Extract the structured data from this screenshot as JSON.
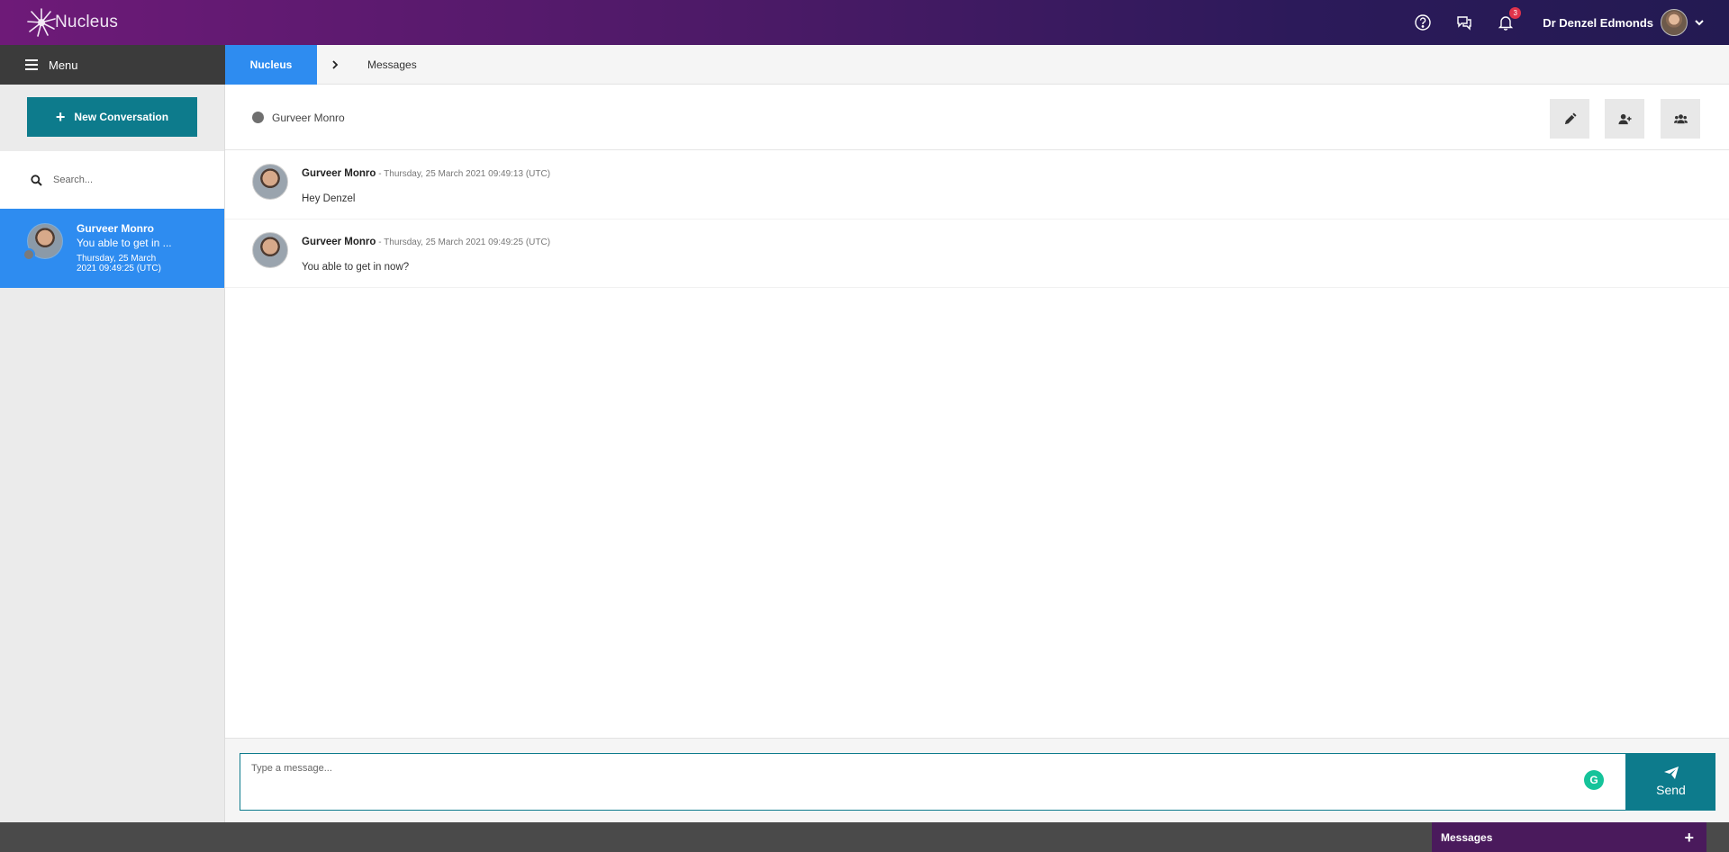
{
  "app": {
    "name": "Nucleus",
    "notification_count": "3",
    "user_name": "Dr Denzel Edmonds"
  },
  "nav": {
    "menu_label": "Menu",
    "breadcrumb": {
      "home": "Nucleus",
      "current": "Messages"
    }
  },
  "sidebar": {
    "new_conversation_label": "New Conversation",
    "search_placeholder": "Search...",
    "conversations": [
      {
        "name": "Gurveer Monro",
        "preview": "You able to get in ...",
        "time": "Thursday, 25 March 2021 09:49:25 (UTC)"
      }
    ]
  },
  "conversation": {
    "participant": "Gurveer Monro",
    "messages": [
      {
        "author": "Gurveer Monro",
        "timestamp": " - Thursday, 25 March 2021 09:49:13 (UTC)",
        "text": "Hey Denzel"
      },
      {
        "author": "Gurveer Monro",
        "timestamp": " - Thursday, 25 March 2021 09:49:25 (UTC)",
        "text": "You able to get in now?"
      }
    ]
  },
  "composer": {
    "placeholder": "Type a message...",
    "send_label": "Send"
  },
  "footer": {
    "messages_label": "Messages"
  },
  "colors": {
    "primary_blue": "#2e8cf0",
    "teal": "#0d7b8c",
    "brand_purple": "#6e1a78"
  }
}
